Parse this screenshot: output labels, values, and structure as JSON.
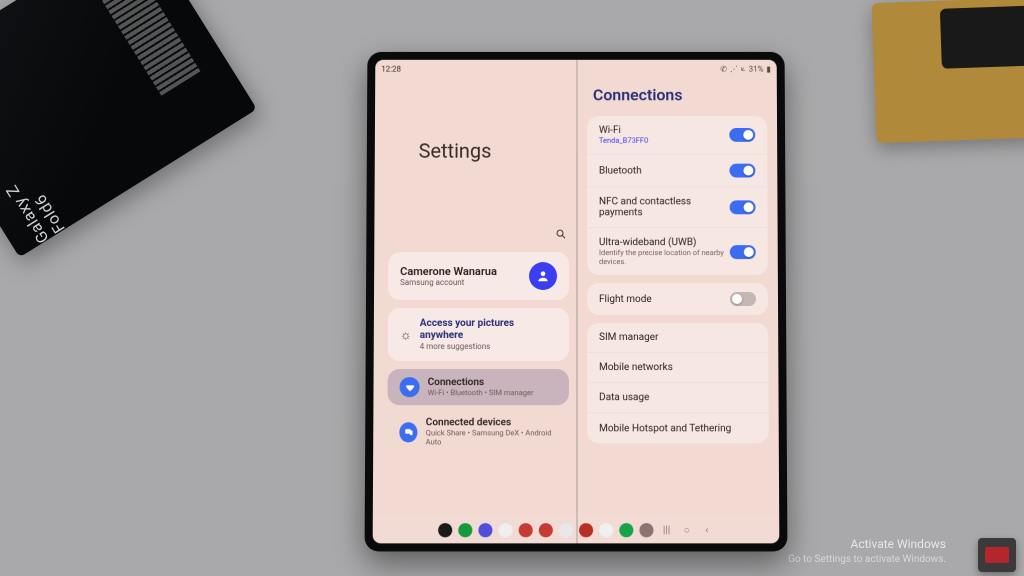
{
  "desk": {
    "box_label": "Galaxy Z Fold6"
  },
  "statusbar": {
    "time": "12:28",
    "battery_text": "31%",
    "icons": {
      "vibrate": true,
      "wifi": true,
      "signal": true,
      "battery": true
    }
  },
  "left": {
    "title": "Settings",
    "account": {
      "name": "Camerone Wanarua",
      "sub": "Samsung account"
    },
    "promo": {
      "title_line1": "Access your pictures",
      "title_line2": "anywhere",
      "sub": "4 more suggestions"
    },
    "nav": {
      "connections": {
        "label": "Connections",
        "desc": "Wi-Fi • Bluetooth • SIM manager"
      },
      "connected_devices": {
        "label": "Connected devices",
        "desc": "Quick Share • Samsung DeX • Android Auto"
      }
    }
  },
  "right": {
    "title": "Connections",
    "group1": [
      {
        "key": "wifi",
        "label": "Wi-Fi",
        "sub": "Tenda_B73FF0",
        "subColor": "blue",
        "toggle": true,
        "on": true
      },
      {
        "key": "bluetooth",
        "label": "Bluetooth",
        "sub": "",
        "toggle": true,
        "on": true
      },
      {
        "key": "nfc",
        "label": "NFC and contactless payments",
        "sub": "",
        "toggle": true,
        "on": true
      },
      {
        "key": "uwb",
        "label": "Ultra-wideband (UWB)",
        "sub": "Identify the precise location of nearby devices.",
        "subColor": "gray",
        "toggle": true,
        "on": true
      }
    ],
    "group2": [
      {
        "key": "flight",
        "label": "Flight mode",
        "toggle": true,
        "on": false
      }
    ],
    "group3": [
      {
        "key": "sim",
        "label": "SIM manager",
        "toggle": false
      },
      {
        "key": "mobnet",
        "label": "Mobile networks",
        "toggle": false
      },
      {
        "key": "datausg",
        "label": "Data usage",
        "toggle": false
      },
      {
        "key": "hotspot",
        "label": "Mobile Hotspot and Tethering",
        "toggle": false
      }
    ]
  },
  "taskbar_colors": [
    "#1a1a1a",
    "#169a3d",
    "#514edc",
    "#efefef",
    "#c43c33",
    "#c43c33",
    "#e8e8e8",
    "#b83023",
    "#f0f0f0",
    "#16a34a",
    "#8a7370"
  ],
  "windows_watermark": {
    "title": "Activate Windows",
    "sub": "Go to Settings to activate Windows."
  }
}
